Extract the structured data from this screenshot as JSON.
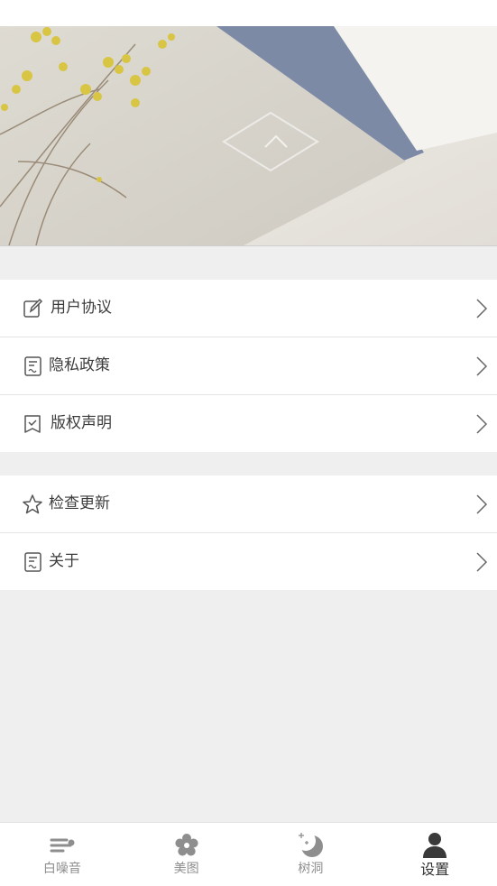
{
  "banner": {
    "image": "open-book-with-dried-yellow-flowers"
  },
  "settings_groups": [
    {
      "items": [
        {
          "label": "用户协议",
          "icon": "edit-icon"
        },
        {
          "label": "隐私政策",
          "icon": "document-icon"
        },
        {
          "label": "版权声明",
          "icon": "check-bookmark-icon"
        }
      ]
    },
    {
      "items": [
        {
          "label": "检查更新",
          "icon": "star-icon"
        },
        {
          "label": "关于",
          "icon": "document-icon"
        }
      ]
    }
  ],
  "tabbar": {
    "tabs": [
      {
        "label": "白噪音",
        "icon": "wind-icon"
      },
      {
        "label": "美图",
        "icon": "flower-icon"
      },
      {
        "label": "树洞",
        "icon": "moon-icon"
      },
      {
        "label": "设置",
        "icon": "user-icon",
        "active": true
      }
    ]
  },
  "colors": {
    "background": "#efefef",
    "text": "#3c3c3c",
    "tab_inactive": "#8e8e8e",
    "tab_active": "#333333"
  }
}
